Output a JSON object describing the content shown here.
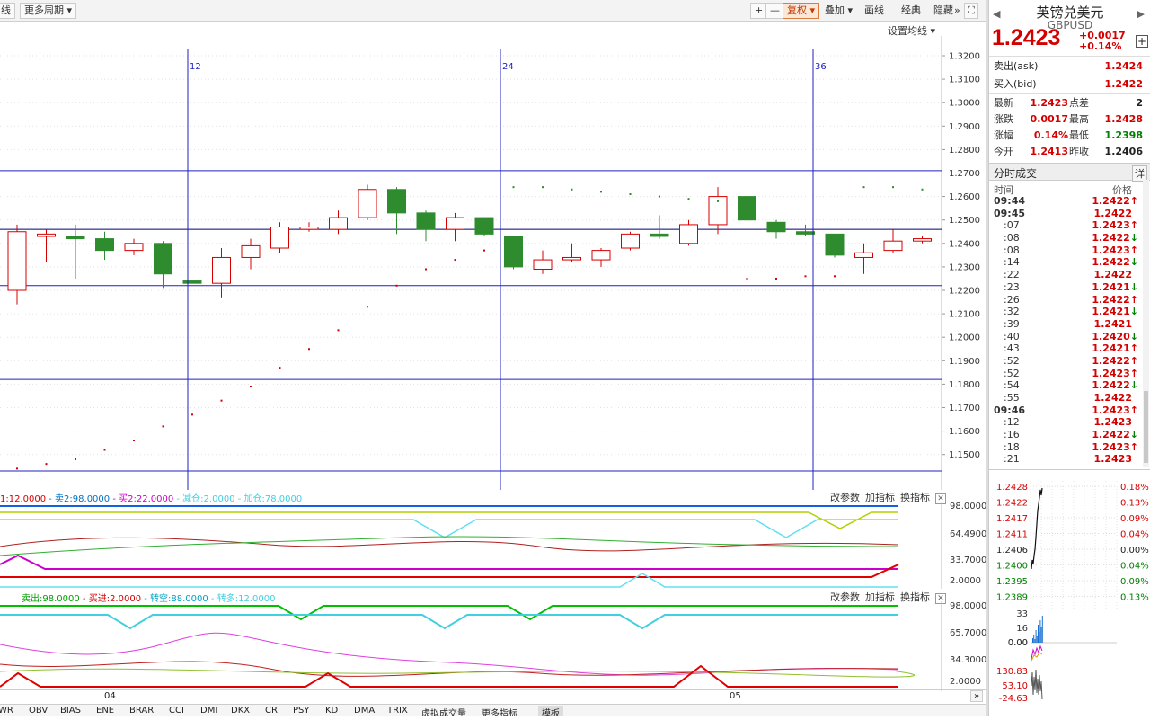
{
  "toolbar": {
    "left_btn": "线",
    "period_btn": "更多周期",
    "plus": "+",
    "minus": "—",
    "rights_btn": "复权",
    "overlay_btn": "叠加",
    "draw_btn": "画线",
    "classic_btn": "经典",
    "hide_btn": "隐藏",
    "more_btn": "»",
    "fullscreen": "⛶"
  },
  "set_ma_label": "设置均线",
  "main_chart": {
    "price_ticks": [
      "1.3200",
      "1.3100",
      "1.3000",
      "1.2900",
      "1.2800",
      "1.2700",
      "1.2600",
      "1.2500",
      "1.2400",
      "1.2300",
      "1.2200",
      "1.2100",
      "1.2000",
      "1.1900",
      "1.1800",
      "1.1700",
      "1.1600",
      "1.1500"
    ],
    "marker_labels": [
      "12",
      "24",
      "36"
    ],
    "candles": [
      {
        "o": 1.22,
        "h": 1.248,
        "l": 1.214,
        "c": 1.245
      },
      {
        "o": 1.243,
        "h": 1.246,
        "l": 1.232,
        "c": 1.244
      },
      {
        "o": 1.243,
        "h": 1.248,
        "l": 1.225,
        "c": 1.242
      },
      {
        "o": 1.242,
        "h": 1.245,
        "l": 1.233,
        "c": 1.237
      },
      {
        "o": 1.237,
        "h": 1.242,
        "l": 1.235,
        "c": 1.24
      },
      {
        "o": 1.24,
        "h": 1.241,
        "l": 1.221,
        "c": 1.227
      },
      {
        "o": 1.224,
        "h": 1.224,
        "l": 1.223,
        "c": 1.223
      },
      {
        "o": 1.223,
        "h": 1.238,
        "l": 1.217,
        "c": 1.234
      },
      {
        "o": 1.234,
        "h": 1.242,
        "l": 1.229,
        "c": 1.239
      },
      {
        "o": 1.238,
        "h": 1.249,
        "l": 1.236,
        "c": 1.247
      },
      {
        "o": 1.246,
        "h": 1.249,
        "l": 1.245,
        "c": 1.247
      },
      {
        "o": 1.246,
        "h": 1.254,
        "l": 1.244,
        "c": 1.251
      },
      {
        "o": 1.251,
        "h": 1.265,
        "l": 1.25,
        "c": 1.263
      },
      {
        "o": 1.263,
        "h": 1.264,
        "l": 1.244,
        "c": 1.253
      },
      {
        "o": 1.253,
        "h": 1.254,
        "l": 1.241,
        "c": 1.246
      },
      {
        "o": 1.246,
        "h": 1.253,
        "l": 1.241,
        "c": 1.251
      },
      {
        "o": 1.251,
        "h": 1.251,
        "l": 1.243,
        "c": 1.244
      },
      {
        "o": 1.243,
        "h": 1.243,
        "l": 1.229,
        "c": 1.23
      },
      {
        "o": 1.229,
        "h": 1.237,
        "l": 1.227,
        "c": 1.233
      },
      {
        "o": 1.233,
        "h": 1.24,
        "l": 1.232,
        "c": 1.234
      },
      {
        "o": 1.233,
        "h": 1.238,
        "l": 1.23,
        "c": 1.237
      },
      {
        "o": 1.238,
        "h": 1.245,
        "l": 1.237,
        "c": 1.244
      },
      {
        "o": 1.244,
        "h": 1.252,
        "l": 1.242,
        "c": 1.243
      },
      {
        "o": 1.24,
        "h": 1.25,
        "l": 1.239,
        "c": 1.248
      },
      {
        "o": 1.248,
        "h": 1.264,
        "l": 1.244,
        "c": 1.26
      },
      {
        "o": 1.26,
        "h": 1.26,
        "l": 1.25,
        "c": 1.25
      },
      {
        "o": 1.249,
        "h": 1.25,
        "l": 1.242,
        "c": 1.245
      },
      {
        "o": 1.245,
        "h": 1.248,
        "l": 1.243,
        "c": 1.244
      },
      {
        "o": 1.244,
        "h": 1.244,
        "l": 1.234,
        "c": 1.235
      },
      {
        "o": 1.234,
        "h": 1.24,
        "l": 1.227,
        "c": 1.236
      },
      {
        "o": 1.237,
        "h": 1.246,
        "l": 1.236,
        "c": 1.241
      },
      {
        "o": 1.241,
        "h": 1.243,
        "l": 1.24,
        "c": 1.242
      }
    ],
    "sar": [
      1.144,
      1.146,
      1.148,
      1.152,
      1.156,
      1.162,
      1.167,
      1.173,
      1.179,
      1.187,
      1.195,
      1.203,
      1.213,
      1.222,
      1.229,
      1.233,
      1.237,
      1.264,
      1.264,
      1.263,
      1.262,
      1.261,
      1.26,
      1.259,
      1.258,
      1.225,
      1.225,
      1.226,
      1.226,
      1.264,
      1.264,
      1.263
    ],
    "hlines": [
      1.271,
      1.246,
      1.222,
      1.182,
      1.143
    ]
  },
  "ind1": {
    "legend": [
      {
        "text": "1:12.0000",
        "color": "#d40000"
      },
      {
        "text": "卖2:98.0000",
        "color": "#0070c0"
      },
      {
        "text": "买2:22.0000",
        "color": "#cc00cc"
      },
      {
        "text": "减仓:2.0000",
        "color": "#40d0e0"
      },
      {
        "text": "加仓:78.0000",
        "color": "#40d0e0"
      }
    ],
    "ticks": [
      "98.0000",
      "64.4900",
      "33.7000",
      "2.0000"
    ]
  },
  "ind2": {
    "legend": [
      {
        "text": "卖出:98.0000",
        "color": "#00a000"
      },
      {
        "text": "买进:2.0000",
        "color": "#d40000"
      },
      {
        "text": "转空:88.0000",
        "color": "#00a0c0"
      },
      {
        "text": "转多:12.0000",
        "color": "#40d0e0"
      }
    ],
    "ticks": [
      "98.0000",
      "65.7000",
      "34.3000",
      "2.0000"
    ]
  },
  "ind_buttons": {
    "change_params": "改参数",
    "add_indicator": "加指标",
    "switch_indicator": "换指标",
    "close": "✕"
  },
  "xaxis": {
    "labels": [
      "04",
      "05"
    ],
    "scroll": "»"
  },
  "bottom_tabs": [
    "WR",
    "OBV",
    "BIAS",
    "ENE",
    "BRAR",
    "CCI",
    "DMI",
    "DKX",
    "CR",
    "PSY",
    "KD",
    "DMA",
    "TRIX",
    "虚拟成交量",
    "更多指标",
    "模板"
  ],
  "right_panel": {
    "title": "英镑兑美元",
    "code": "GBPUSD",
    "price": "1.2423",
    "change": "+0.0017",
    "change_pct": "+0.14%",
    "plus": "+",
    "ask_label": "卖出(ask)",
    "ask": "1.2424",
    "bid_label": "买入(bid)",
    "bid": "1.2422",
    "stats": [
      {
        "label": "最新",
        "value": "1.2423",
        "color": "red",
        "label2": "点差",
        "value2": "2",
        "color2": "black"
      },
      {
        "label": "涨跌",
        "value": "0.0017",
        "color": "red",
        "label2": "最高",
        "value2": "1.2428",
        "color2": "red"
      },
      {
        "label": "涨幅",
        "value": "0.14%",
        "color": "red",
        "label2": "最低",
        "value2": "1.2398",
        "color2": "green"
      },
      {
        "label": "今开",
        "value": "1.2413",
        "color": "red",
        "label2": "昨收",
        "value2": "1.2406",
        "color2": "black"
      }
    ],
    "ticks_title": "分时成交",
    "ticks_detail": "详",
    "col_time": "时间",
    "col_price": "价格",
    "ticks": [
      {
        "t": "09:44",
        "p": "1.2422",
        "d": "up",
        "big": true
      },
      {
        "t": "09:45",
        "p": "1.2422",
        "d": "",
        "big": true
      },
      {
        "t": ":07",
        "p": "1.2423",
        "d": "up"
      },
      {
        "t": ":08",
        "p": "1.2422",
        "d": "down"
      },
      {
        "t": ":08",
        "p": "1.2423",
        "d": "up"
      },
      {
        "t": ":14",
        "p": "1.2422",
        "d": "down"
      },
      {
        "t": ":22",
        "p": "1.2422",
        "d": ""
      },
      {
        "t": ":23",
        "p": "1.2421",
        "d": "down"
      },
      {
        "t": ":26",
        "p": "1.2422",
        "d": "up"
      },
      {
        "t": ":32",
        "p": "1.2421",
        "d": "down"
      },
      {
        "t": ":39",
        "p": "1.2421",
        "d": ""
      },
      {
        "t": ":40",
        "p": "1.2420",
        "d": "down"
      },
      {
        "t": ":43",
        "p": "1.2421",
        "d": "up"
      },
      {
        "t": ":52",
        "p": "1.2422",
        "d": "up"
      },
      {
        "t": ":52",
        "p": "1.2423",
        "d": "up"
      },
      {
        "t": ":54",
        "p": "1.2422",
        "d": "down"
      },
      {
        "t": ":55",
        "p": "1.2422",
        "d": ""
      },
      {
        "t": "09:46",
        "p": "1.2423",
        "d": "up",
        "big": true
      },
      {
        "t": ":12",
        "p": "1.2423",
        "d": ""
      },
      {
        "t": ":16",
        "p": "1.2422",
        "d": "down"
      },
      {
        "t": ":18",
        "p": "1.2423",
        "d": "up"
      },
      {
        "t": ":21",
        "p": "1.2423",
        "d": ""
      }
    ],
    "mini_prices": [
      {
        "v": "1.2428",
        "c": "red"
      },
      {
        "v": "1.2422",
        "c": "red"
      },
      {
        "v": "1.2417",
        "c": "red"
      },
      {
        "v": "1.2411",
        "c": "red"
      },
      {
        "v": "1.2406",
        "c": "black"
      },
      {
        "v": "1.2400",
        "c": "green"
      },
      {
        "v": "1.2395",
        "c": "green"
      },
      {
        "v": "1.2389",
        "c": "green"
      }
    ],
    "mini_pcts": [
      {
        "v": "0.18%",
        "c": "red"
      },
      {
        "v": "0.13%",
        "c": "red"
      },
      {
        "v": "0.09%",
        "c": "red"
      },
      {
        "v": "0.04%",
        "c": "red"
      },
      {
        "v": "0.00%",
        "c": "black"
      },
      {
        "v": "0.04%",
        "c": "green"
      },
      {
        "v": "0.09%",
        "c": "green"
      },
      {
        "v": "0.13%",
        "c": "green"
      }
    ],
    "mini_vol_ticks": [
      "33",
      "16",
      "0.00"
    ],
    "mini_macd_ticks": [
      "0.00"
    ],
    "mini_ind_ticks": [
      "130.83",
      "53.10",
      "-24.63"
    ]
  },
  "colors": {
    "up": "#d40000",
    "down": "#2e8b2e",
    "hline": "#0000c0",
    "sar": "#d40000"
  }
}
